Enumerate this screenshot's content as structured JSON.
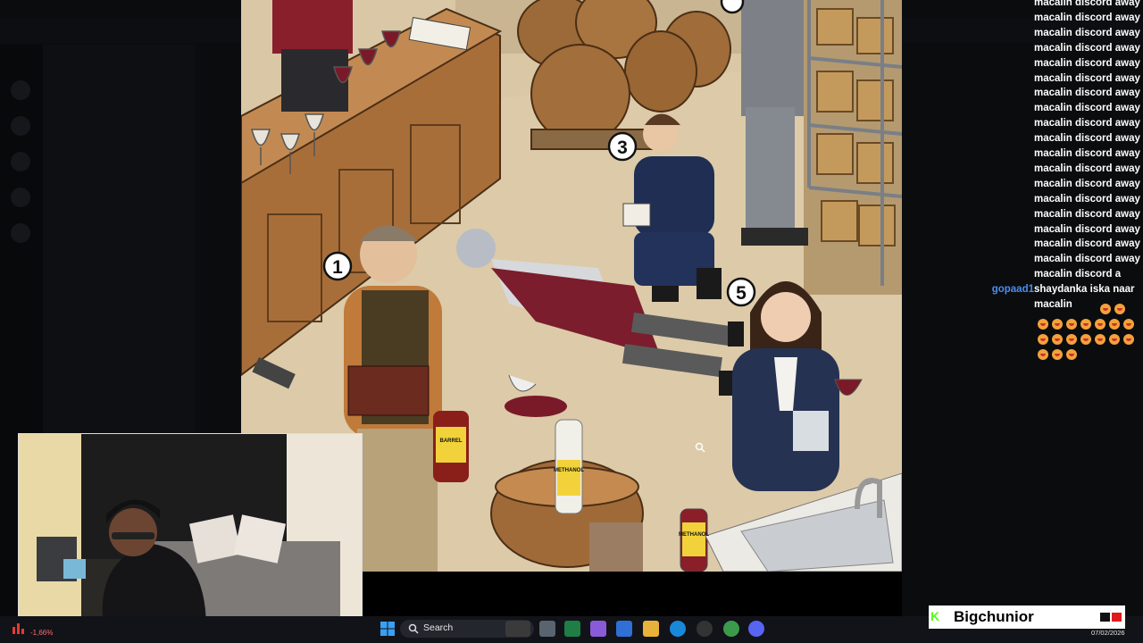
{
  "scene": {
    "marker_labels": [
      "1",
      "3",
      "5"
    ],
    "bottle_labels": {
      "barrel_bottle": "BARREL",
      "methanol_1": "METHANOL",
      "methanol_2": "METHANOL"
    }
  },
  "chat": {
    "messages": [
      {
        "user": "",
        "text": "macalin discord away"
      },
      {
        "user": "",
        "text": "macalin discord away"
      },
      {
        "user": "",
        "text": "macalin discord away"
      },
      {
        "user": "",
        "text": "macalin discord away"
      },
      {
        "user": "",
        "text": "macalin discord away"
      },
      {
        "user": "",
        "text": "macalin discord away"
      },
      {
        "user": "",
        "text": "macalin discord away"
      },
      {
        "user": "",
        "text": "macalin discord away"
      },
      {
        "user": "",
        "text": "macalin discord away"
      },
      {
        "user": "",
        "text": "macalin discord away"
      },
      {
        "user": "",
        "text": "macalin discord away"
      },
      {
        "user": "",
        "text": "macalin discord away"
      },
      {
        "user": "",
        "text": "macalin discord away"
      },
      {
        "user": "",
        "text": "macalin discord away"
      },
      {
        "user": "",
        "text": "macalin discord away"
      },
      {
        "user": "",
        "text": "macalin discord away"
      },
      {
        "user": "",
        "text": "macalin discord away"
      },
      {
        "user": "",
        "text": "macalin discord away"
      },
      {
        "user": "",
        "text": "macalin discord a"
      },
      {
        "user": "gopaad1",
        "text": "shaydanka iska naar"
      },
      {
        "user": "",
        "text": "macalin"
      }
    ],
    "emote_name": "laughing-face-emote"
  },
  "taskbar": {
    "search_label": "Search",
    "stock_change": "-1,66%",
    "date": "07/02/2026"
  },
  "overlay": {
    "streamer_name": "Bigchunior",
    "accent": "#53fc18"
  }
}
